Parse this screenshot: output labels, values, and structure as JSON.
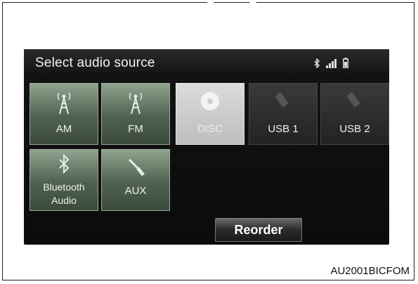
{
  "screen": {
    "title": "Select audio source",
    "status_icons": [
      "bluetooth-icon",
      "signal-strength-icon",
      "battery-icon"
    ]
  },
  "sources": [
    {
      "label": "AM",
      "icon": "radio-tower-icon",
      "state": "available"
    },
    {
      "label": "FM",
      "icon": "radio-tower-icon",
      "state": "available"
    },
    {
      "label": "DISC",
      "icon": "disc-icon",
      "state": "selected"
    },
    {
      "label": "USB 1",
      "icon": "usb-icon",
      "state": "unavailable"
    },
    {
      "label": "USB 2",
      "icon": "usb-icon",
      "state": "unavailable"
    },
    {
      "label": "Bluetooth\nAudio",
      "icon": "bluetooth-icon",
      "state": "available"
    },
    {
      "label": "AUX",
      "icon": "aux-plug-icon",
      "state": "available"
    }
  ],
  "reorder_label": "Reorder",
  "figure_code": "AU2001BICFOM",
  "colors": {
    "available": "#5f735f",
    "selected": "#cfcfcf",
    "unavailable": "#2e2e2e",
    "screen_bg": "#111111"
  }
}
